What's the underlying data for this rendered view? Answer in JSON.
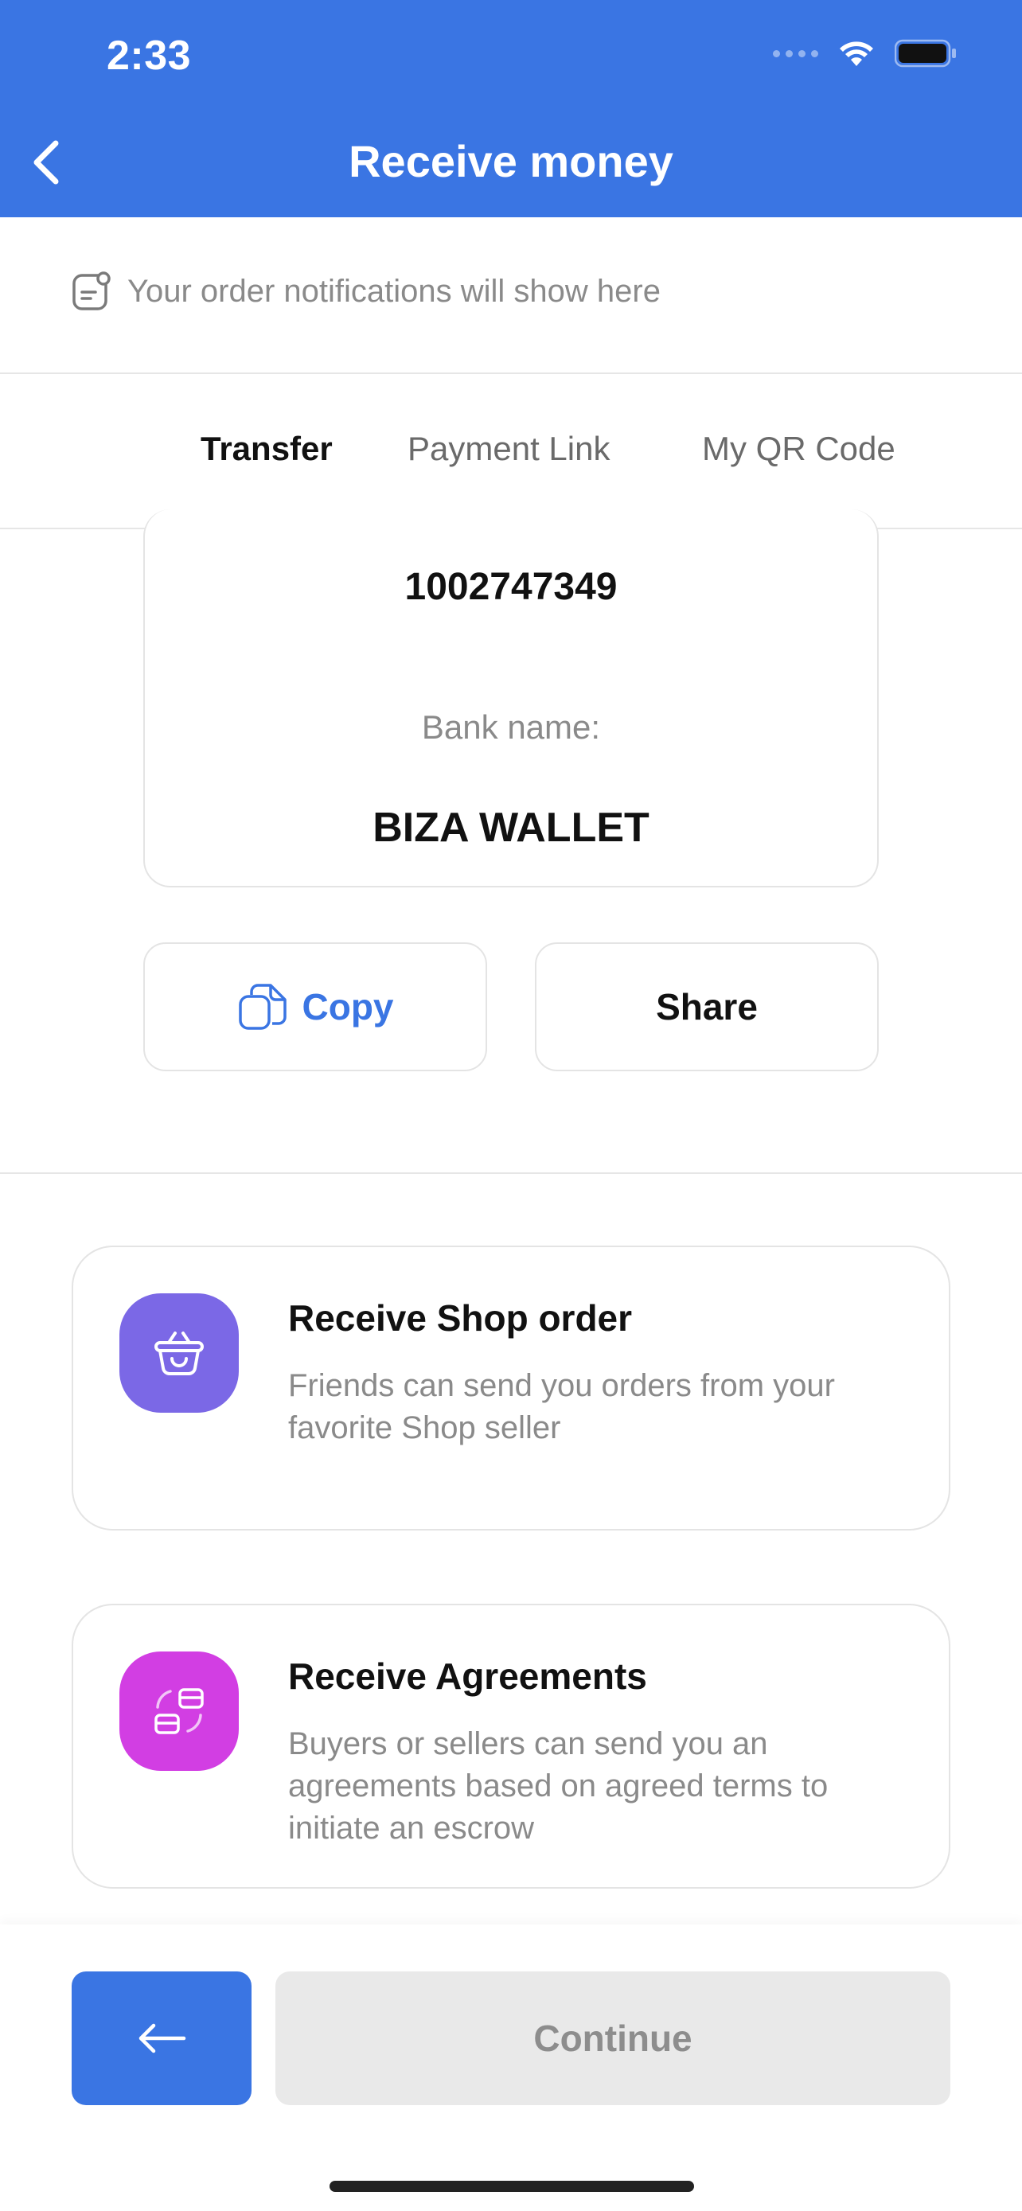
{
  "status_bar": {
    "time": "2:33"
  },
  "header": {
    "title": "Receive money"
  },
  "notification": {
    "text": "Your order notifications will show here"
  },
  "tabs": [
    {
      "label": "Transfer",
      "active": true
    },
    {
      "label": "Payment Link",
      "active": false
    },
    {
      "label": "My QR Code",
      "active": false
    }
  ],
  "account": {
    "number": "1002747349",
    "bank_label": "Bank name:",
    "bank_name": "BIZA WALLET"
  },
  "actions": {
    "copy_label": "Copy",
    "share_label": "Share"
  },
  "features": [
    {
      "title": "Receive Shop order",
      "description": "Friends can send you orders from your favorite Shop seller",
      "icon": "basket-icon",
      "color": "#7b68e6"
    },
    {
      "title": "Receive Agreements",
      "description": "Buyers or sellers can send you an agreements based on agreed terms to initiate an escrow",
      "icon": "agreement-icon",
      "color": "#d23ee3"
    }
  ],
  "footer": {
    "continue_label": "Continue"
  },
  "colors": {
    "primary": "#3a75e3",
    "muted": "#8a8a8a"
  }
}
